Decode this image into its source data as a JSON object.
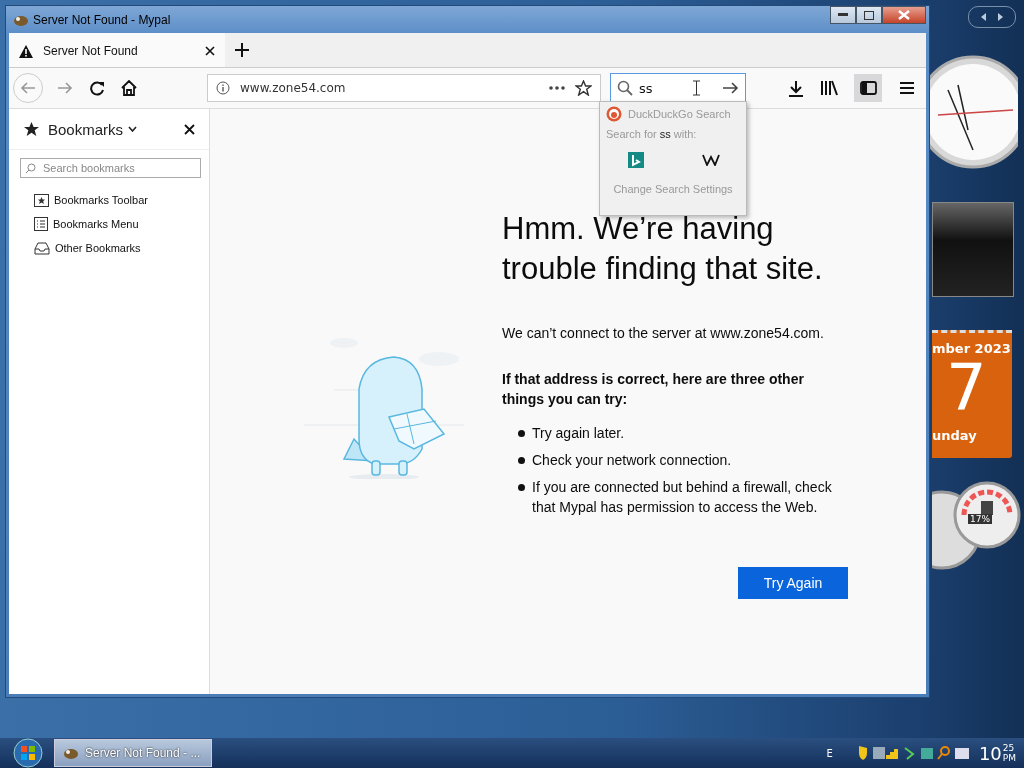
{
  "window": {
    "title": "Server Not Found - Mypal"
  },
  "tabs": [
    {
      "label": "Server Not Found",
      "selected": true
    }
  ],
  "toolbar": {
    "url": "www.zone54.com",
    "search_value": "ss",
    "sidebar_button_on": true
  },
  "search_popup": {
    "engine": "DuckDuckGo Search",
    "prompt_prefix": "Search for",
    "query": "ss",
    "prompt_suffix": "with:",
    "settings": "Change Search Settings"
  },
  "sidebar": {
    "title": "Bookmarks",
    "search_placeholder": "Search bookmarks",
    "items": [
      {
        "label": "Bookmarks Toolbar",
        "kind": "toolbar"
      },
      {
        "label": "Bookmarks Menu",
        "kind": "menu"
      },
      {
        "label": "Other Bookmarks",
        "kind": "other"
      }
    ]
  },
  "error": {
    "heading": "Hmm. We’re having trouble finding that site.",
    "message": "We can’t connect to the server at www.zone54.com.",
    "subheading": "If that address is correct, here are three other things you can try:",
    "tips": [
      "Try again later.",
      "Check your network connection.",
      "If you are connected but behind a firewall, check that Mypal has permission to access the Web."
    ],
    "button": "Try Again"
  },
  "gadgets": {
    "calendar_month": "mber 2023",
    "calendar_day": "7",
    "calendar_weekday": "unday",
    "cpu_reading": "17%"
  },
  "taskbar": {
    "task": "Server Not Found - ...",
    "tray_letter": "E",
    "clock_hour": "10",
    "clock_minute": "25",
    "clock_period": "PM"
  }
}
